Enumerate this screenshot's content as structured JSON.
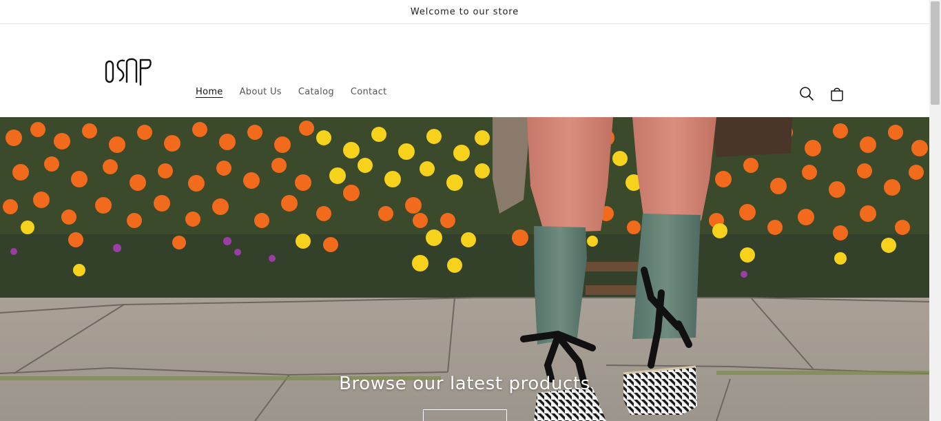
{
  "announcement": {
    "text": "Welcome to our store"
  },
  "header": {
    "logo_alt": "0SAP",
    "nav": [
      {
        "label": "Home",
        "active": true
      },
      {
        "label": "About Us",
        "active": false
      },
      {
        "label": "Catalog",
        "active": false
      },
      {
        "label": "Contact",
        "active": false
      }
    ],
    "icons": {
      "search": "search-icon",
      "cart": "cart-icon"
    }
  },
  "hero": {
    "title": "Browse our latest products",
    "button_label": ""
  },
  "colors": {
    "text": "#121212",
    "muted": "#555555",
    "border": "#e6e6e6",
    "hero_text": "#ffffff"
  }
}
